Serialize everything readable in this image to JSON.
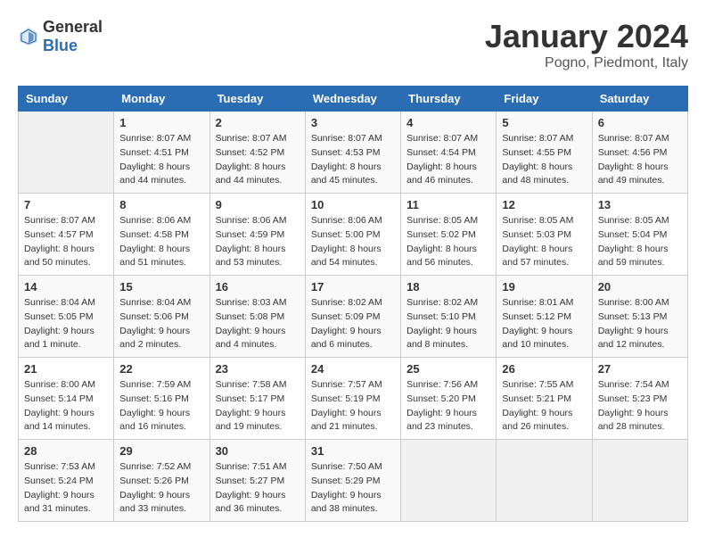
{
  "header": {
    "logo_general": "General",
    "logo_blue": "Blue",
    "title": "January 2024",
    "subtitle": "Pogno, Piedmont, Italy"
  },
  "weekdays": [
    "Sunday",
    "Monday",
    "Tuesday",
    "Wednesday",
    "Thursday",
    "Friday",
    "Saturday"
  ],
  "weeks": [
    [
      {
        "day": "",
        "empty": true
      },
      {
        "day": "1",
        "sunrise": "Sunrise: 8:07 AM",
        "sunset": "Sunset: 4:51 PM",
        "daylight": "Daylight: 8 hours and 44 minutes."
      },
      {
        "day": "2",
        "sunrise": "Sunrise: 8:07 AM",
        "sunset": "Sunset: 4:52 PM",
        "daylight": "Daylight: 8 hours and 44 minutes."
      },
      {
        "day": "3",
        "sunrise": "Sunrise: 8:07 AM",
        "sunset": "Sunset: 4:53 PM",
        "daylight": "Daylight: 8 hours and 45 minutes."
      },
      {
        "day": "4",
        "sunrise": "Sunrise: 8:07 AM",
        "sunset": "Sunset: 4:54 PM",
        "daylight": "Daylight: 8 hours and 46 minutes."
      },
      {
        "day": "5",
        "sunrise": "Sunrise: 8:07 AM",
        "sunset": "Sunset: 4:55 PM",
        "daylight": "Daylight: 8 hours and 48 minutes."
      },
      {
        "day": "6",
        "sunrise": "Sunrise: 8:07 AM",
        "sunset": "Sunset: 4:56 PM",
        "daylight": "Daylight: 8 hours and 49 minutes."
      }
    ],
    [
      {
        "day": "7",
        "sunrise": "Sunrise: 8:07 AM",
        "sunset": "Sunset: 4:57 PM",
        "daylight": "Daylight: 8 hours and 50 minutes."
      },
      {
        "day": "8",
        "sunrise": "Sunrise: 8:06 AM",
        "sunset": "Sunset: 4:58 PM",
        "daylight": "Daylight: 8 hours and 51 minutes."
      },
      {
        "day": "9",
        "sunrise": "Sunrise: 8:06 AM",
        "sunset": "Sunset: 4:59 PM",
        "daylight": "Daylight: 8 hours and 53 minutes."
      },
      {
        "day": "10",
        "sunrise": "Sunrise: 8:06 AM",
        "sunset": "Sunset: 5:00 PM",
        "daylight": "Daylight: 8 hours and 54 minutes."
      },
      {
        "day": "11",
        "sunrise": "Sunrise: 8:05 AM",
        "sunset": "Sunset: 5:02 PM",
        "daylight": "Daylight: 8 hours and 56 minutes."
      },
      {
        "day": "12",
        "sunrise": "Sunrise: 8:05 AM",
        "sunset": "Sunset: 5:03 PM",
        "daylight": "Daylight: 8 hours and 57 minutes."
      },
      {
        "day": "13",
        "sunrise": "Sunrise: 8:05 AM",
        "sunset": "Sunset: 5:04 PM",
        "daylight": "Daylight: 8 hours and 59 minutes."
      }
    ],
    [
      {
        "day": "14",
        "sunrise": "Sunrise: 8:04 AM",
        "sunset": "Sunset: 5:05 PM",
        "daylight": "Daylight: 9 hours and 1 minute."
      },
      {
        "day": "15",
        "sunrise": "Sunrise: 8:04 AM",
        "sunset": "Sunset: 5:06 PM",
        "daylight": "Daylight: 9 hours and 2 minutes."
      },
      {
        "day": "16",
        "sunrise": "Sunrise: 8:03 AM",
        "sunset": "Sunset: 5:08 PM",
        "daylight": "Daylight: 9 hours and 4 minutes."
      },
      {
        "day": "17",
        "sunrise": "Sunrise: 8:02 AM",
        "sunset": "Sunset: 5:09 PM",
        "daylight": "Daylight: 9 hours and 6 minutes."
      },
      {
        "day": "18",
        "sunrise": "Sunrise: 8:02 AM",
        "sunset": "Sunset: 5:10 PM",
        "daylight": "Daylight: 9 hours and 8 minutes."
      },
      {
        "day": "19",
        "sunrise": "Sunrise: 8:01 AM",
        "sunset": "Sunset: 5:12 PM",
        "daylight": "Daylight: 9 hours and 10 minutes."
      },
      {
        "day": "20",
        "sunrise": "Sunrise: 8:00 AM",
        "sunset": "Sunset: 5:13 PM",
        "daylight": "Daylight: 9 hours and 12 minutes."
      }
    ],
    [
      {
        "day": "21",
        "sunrise": "Sunrise: 8:00 AM",
        "sunset": "Sunset: 5:14 PM",
        "daylight": "Daylight: 9 hours and 14 minutes."
      },
      {
        "day": "22",
        "sunrise": "Sunrise: 7:59 AM",
        "sunset": "Sunset: 5:16 PM",
        "daylight": "Daylight: 9 hours and 16 minutes."
      },
      {
        "day": "23",
        "sunrise": "Sunrise: 7:58 AM",
        "sunset": "Sunset: 5:17 PM",
        "daylight": "Daylight: 9 hours and 19 minutes."
      },
      {
        "day": "24",
        "sunrise": "Sunrise: 7:57 AM",
        "sunset": "Sunset: 5:19 PM",
        "daylight": "Daylight: 9 hours and 21 minutes."
      },
      {
        "day": "25",
        "sunrise": "Sunrise: 7:56 AM",
        "sunset": "Sunset: 5:20 PM",
        "daylight": "Daylight: 9 hours and 23 minutes."
      },
      {
        "day": "26",
        "sunrise": "Sunrise: 7:55 AM",
        "sunset": "Sunset: 5:21 PM",
        "daylight": "Daylight: 9 hours and 26 minutes."
      },
      {
        "day": "27",
        "sunrise": "Sunrise: 7:54 AM",
        "sunset": "Sunset: 5:23 PM",
        "daylight": "Daylight: 9 hours and 28 minutes."
      }
    ],
    [
      {
        "day": "28",
        "sunrise": "Sunrise: 7:53 AM",
        "sunset": "Sunset: 5:24 PM",
        "daylight": "Daylight: 9 hours and 31 minutes."
      },
      {
        "day": "29",
        "sunrise": "Sunrise: 7:52 AM",
        "sunset": "Sunset: 5:26 PM",
        "daylight": "Daylight: 9 hours and 33 minutes."
      },
      {
        "day": "30",
        "sunrise": "Sunrise: 7:51 AM",
        "sunset": "Sunset: 5:27 PM",
        "daylight": "Daylight: 9 hours and 36 minutes."
      },
      {
        "day": "31",
        "sunrise": "Sunrise: 7:50 AM",
        "sunset": "Sunset: 5:29 PM",
        "daylight": "Daylight: 9 hours and 38 minutes."
      },
      {
        "day": "",
        "empty": true
      },
      {
        "day": "",
        "empty": true
      },
      {
        "day": "",
        "empty": true
      }
    ]
  ]
}
